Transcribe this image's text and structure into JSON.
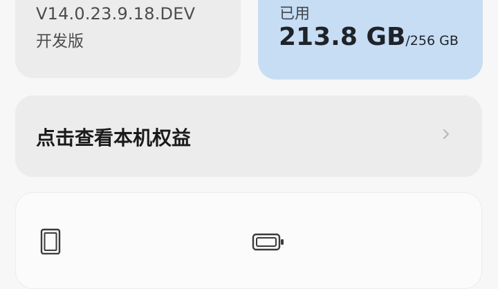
{
  "system_card": {
    "version": "V14.0.23.9.18.DEV",
    "build_type": "开发版"
  },
  "storage_card": {
    "label": "已用",
    "used": "213.8 GB",
    "total": "/256 GB"
  },
  "benefits_row": {
    "label": "点击查看本机权益",
    "icon": "chevron-right-icon"
  },
  "info_card": {
    "icons": [
      "phone-icon",
      "battery-icon"
    ]
  },
  "colors": {
    "page_background": "#f7f7f7",
    "card_background": "#ececec",
    "storage_card_background": "#c6ddf4"
  }
}
